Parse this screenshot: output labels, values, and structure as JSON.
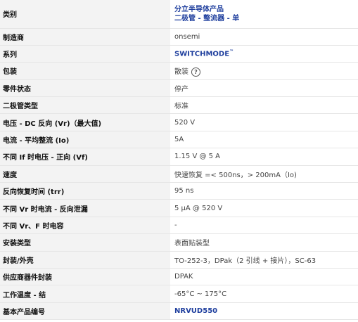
{
  "rows": [
    {
      "label": "类别",
      "values": [
        "分立半导体产品",
        "二极管 - 整流器 - 单"
      ]
    },
    {
      "label": "制造商",
      "value": "onsemi"
    },
    {
      "label": "系列",
      "value": "SWITCHMODE",
      "suffix": "™"
    },
    {
      "label": "包装",
      "value": "散装",
      "icon": "help-icon"
    },
    {
      "label": "零件状态",
      "value": "停产"
    },
    {
      "label": "二极管类型",
      "value": "标准"
    },
    {
      "label": "电压 - DC 反向 (Vr)（最大值)",
      "value": "520 V"
    },
    {
      "label": "电流 - 平均整流 (Io)",
      "value": "5A"
    },
    {
      "label": "不同 If 时电压 - 正向 (Vf)",
      "value": "1.15 V @ 5 A"
    },
    {
      "label": "速度",
      "value": "快速恢复 =< 500ns，> 200mA（Io)"
    },
    {
      "label": "反向恢复时间 (trr)",
      "value": "95 ns"
    },
    {
      "label": "不同 Vr 时电流 - 反向泄漏",
      "value": "5 µA @ 520 V"
    },
    {
      "label": "不同 Vr、F 时电容",
      "value": "-"
    },
    {
      "label": "安装类型",
      "value": "表面贴装型"
    },
    {
      "label": "封装/外壳",
      "value": "TO-252-3，DPak（2 引线 + 接片），SC-63"
    },
    {
      "label": "供应商器件封装",
      "value": "DPAK"
    },
    {
      "label": "工作温度 - 结",
      "value": "-65°C ~ 175°C"
    },
    {
      "label": "基本产品编号",
      "value": "NRVUD550"
    }
  ],
  "colors": {
    "label_bg": "#f3f3f3",
    "link": "#1f3f9e",
    "border": "#e6e6e6"
  }
}
